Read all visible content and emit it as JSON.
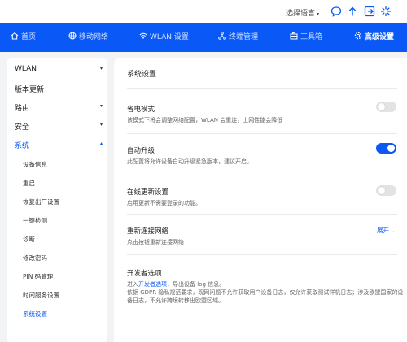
{
  "topbar": {
    "language_label": "选择语言",
    "language_caret": "▾",
    "icons": [
      "feedback-icon",
      "upload-icon",
      "logout-icon",
      "loading-icon"
    ]
  },
  "colors": {
    "accent": "#0a59f7",
    "nav_background": "#0a59f7",
    "toggle_off": "#e3e3e3"
  },
  "nav": {
    "items": [
      {
        "label": "首页",
        "icon": "home-icon"
      },
      {
        "label": "移动网络",
        "icon": "globe-icon"
      },
      {
        "label": "WLAN 设置",
        "icon": "wifi-icon"
      },
      {
        "label": "终端管理",
        "icon": "devices-icon"
      },
      {
        "label": "工具箱",
        "icon": "toolbox-icon"
      },
      {
        "label": "高级设置",
        "icon": "gear-icon",
        "active": true
      }
    ]
  },
  "sidebar": {
    "items": [
      {
        "label": "WLAN",
        "expandable": true,
        "chevron": "▾"
      },
      {
        "label": "版本更新"
      },
      {
        "label": "路由",
        "expandable": true,
        "chevron": "▾"
      },
      {
        "label": "安全",
        "expandable": true,
        "chevron": "▾"
      },
      {
        "label": "系统",
        "expandable": true,
        "expanded": true,
        "active": true,
        "chevron": "▴"
      }
    ],
    "sub_items": [
      {
        "label": "设备信息"
      },
      {
        "label": "重启"
      },
      {
        "label": "恢复出厂设置"
      },
      {
        "label": "一键检测"
      },
      {
        "label": "诊断"
      },
      {
        "label": "修改密码"
      },
      {
        "label": "PIN 码管理"
      },
      {
        "label": "时间服务设置"
      },
      {
        "label": "系统设置",
        "active": true
      }
    ]
  },
  "main": {
    "title": "系统设置",
    "settings": [
      {
        "title": "省电模式",
        "description": "该模式下将会调整网络配置，WLAN 会重连，上网性能会降低",
        "enabled": false
      },
      {
        "title": "自动升级",
        "description": "此配置将允许设备自动升级紧急版本，建议开启。",
        "enabled": true
      },
      {
        "title": "在线更新设置",
        "description": "启用更新不需要登录的功能。",
        "enabled": false
      },
      {
        "title": "重新连接网络",
        "description": "点击按钮重新连接网络",
        "action": "展开",
        "action_chevron": "⌄"
      }
    ],
    "developer": {
      "title": "开发者选项",
      "desc_prefix": "进入",
      "link": "开发者选项",
      "desc_suffix": "，导出设备 log 信息。",
      "desc_line2": "依据 GDPR 隐私规范要求，现网问题不允许获取用户设备日志，仅允许获取测试样机日志；涉及欧盟国家的设",
      "desc_line3": "备日志，不允许跨境转移出欧盟区域。"
    }
  }
}
